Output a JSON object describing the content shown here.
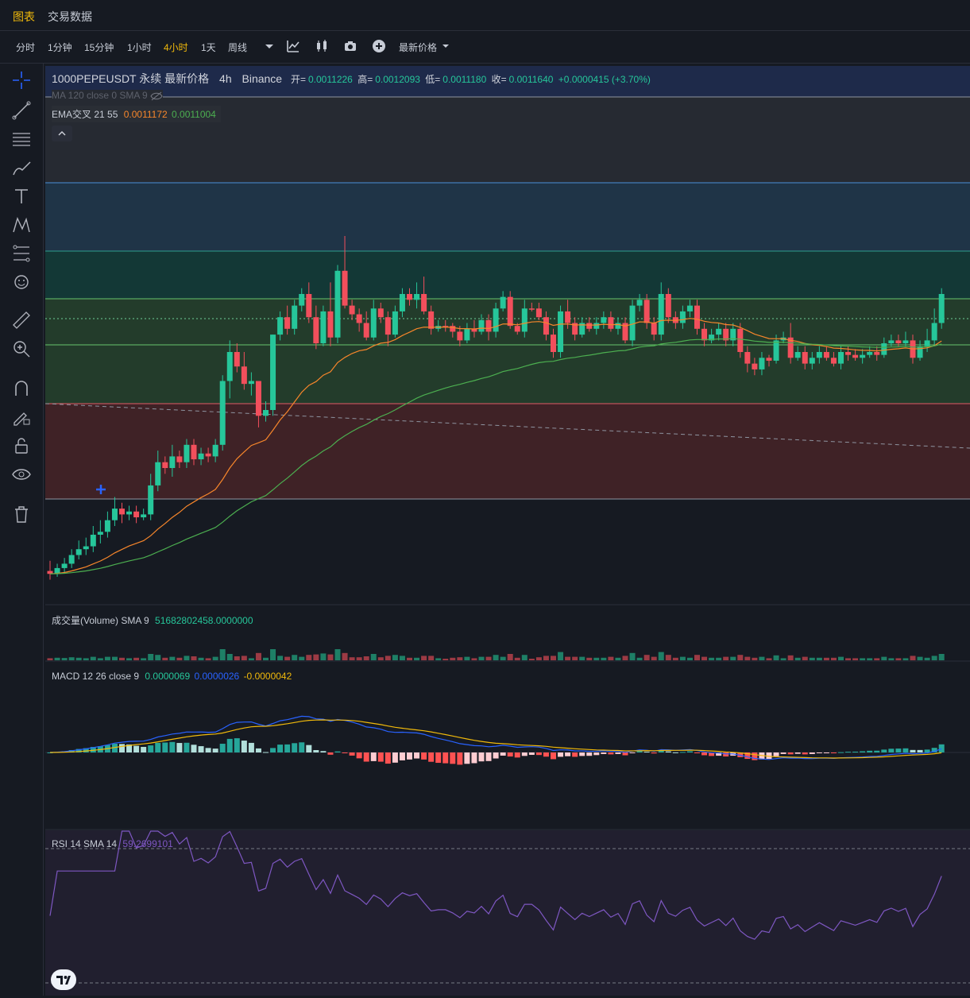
{
  "top_tabs": [
    {
      "label": "图表",
      "active": true
    },
    {
      "label": "交易数据",
      "active": false
    }
  ],
  "timeframes": [
    {
      "label": "分时",
      "active": false
    },
    {
      "label": "1分钟",
      "active": false
    },
    {
      "label": "15分钟",
      "active": false
    },
    {
      "label": "1小时",
      "active": false
    },
    {
      "label": "4小时",
      "active": true
    },
    {
      "label": "1天",
      "active": false
    },
    {
      "label": "周线",
      "active": false
    }
  ],
  "price_type_label": "最新价格",
  "header": {
    "symbol": "1000PEPEUSDT 永续 最新价格",
    "interval": "4h",
    "exchange": "Binance",
    "open_label": "开=",
    "open": "0.0011226",
    "high_label": "高=",
    "high": "0.0012093",
    "low_label": "低=",
    "low": "0.0011180",
    "close_label": "收=",
    "close": "0.0011640",
    "change": "+0.0000415 (+3.70%)"
  },
  "ma_legend": "MA 120 close 0 SMA 9",
  "ema_legend": {
    "label": "EMA交叉 21 55",
    "v1": "0.0011172",
    "v2": "0.0011004"
  },
  "volume_legend": {
    "label": "成交量(Volume) SMA 9",
    "value": "51682802458.0000000"
  },
  "macd_legend": {
    "label": "MACD 12 26 close 9",
    "hist": "0.0000069",
    "macd": "0.0000026",
    "signal": "-0.0000042"
  },
  "rsi_legend": {
    "label": "RSI 14 SMA 14",
    "value": "59.2699101"
  },
  "colors": {
    "up": "#26c69a",
    "down": "#f24f5c",
    "accent": "#f0b90b",
    "ema_fast": "#f7862b",
    "ema_slow": "#4caf50",
    "macd_line": "#2962ff",
    "signal_line": "#f0b90b",
    "rsi": "#7e57c2"
  },
  "chart_data": {
    "type": "candlestick",
    "symbol": "1000PEPEUSDT",
    "interval": "4h",
    "candles_rel": [
      [
        0.955,
        0.965,
        0.92,
        0.985
      ],
      [
        0.965,
        0.945,
        0.93,
        0.975
      ],
      [
        0.945,
        0.93,
        0.91,
        0.96
      ],
      [
        0.93,
        0.9,
        0.88,
        0.945
      ],
      [
        0.9,
        0.88,
        0.85,
        0.915
      ],
      [
        0.88,
        0.87,
        0.84,
        0.9
      ],
      [
        0.87,
        0.83,
        0.8,
        0.89
      ],
      [
        0.83,
        0.82,
        0.78,
        0.86
      ],
      [
        0.82,
        0.78,
        0.75,
        0.84
      ],
      [
        0.78,
        0.74,
        0.7,
        0.8
      ],
      [
        0.74,
        0.76,
        0.72,
        0.79
      ],
      [
        0.76,
        0.75,
        0.73,
        0.78
      ],
      [
        0.75,
        0.77,
        0.73,
        0.79
      ],
      [
        0.77,
        0.76,
        0.74,
        0.78
      ],
      [
        0.76,
        0.66,
        0.62,
        0.78
      ],
      [
        0.66,
        0.58,
        0.54,
        0.68
      ],
      [
        0.58,
        0.6,
        0.56,
        0.62
      ],
      [
        0.6,
        0.56,
        0.52,
        0.63
      ],
      [
        0.56,
        0.58,
        0.54,
        0.6
      ],
      [
        0.58,
        0.52,
        0.5,
        0.6
      ],
      [
        0.52,
        0.57,
        0.5,
        0.59
      ],
      [
        0.57,
        0.55,
        0.53,
        0.59
      ],
      [
        0.55,
        0.56,
        0.53,
        0.58
      ],
      [
        0.56,
        0.52,
        0.5,
        0.58
      ],
      [
        0.52,
        0.3,
        0.28,
        0.54
      ],
      [
        0.3,
        0.2,
        0.16,
        0.36
      ],
      [
        0.2,
        0.25,
        0.17,
        0.27
      ],
      [
        0.25,
        0.31,
        0.2,
        0.33
      ],
      [
        0.31,
        0.3,
        0.27,
        0.35
      ],
      [
        0.3,
        0.42,
        0.3,
        0.46
      ],
      [
        0.42,
        0.4,
        0.37,
        0.44
      ],
      [
        0.4,
        0.14,
        0.14,
        0.42
      ],
      [
        0.14,
        0.08,
        0.06,
        0.16
      ],
      [
        0.08,
        0.12,
        0.04,
        0.14
      ],
      [
        0.12,
        0.04,
        0.02,
        0.14
      ],
      [
        0.04,
        0.0,
        -0.02,
        0.06
      ],
      [
        0.0,
        0.08,
        -0.04,
        0.1
      ],
      [
        0.08,
        0.17,
        0.04,
        0.19
      ],
      [
        0.17,
        0.06,
        0.04,
        0.18
      ],
      [
        0.06,
        0.15,
        -0.04,
        0.18
      ],
      [
        0.15,
        -0.08,
        -0.1,
        0.17
      ],
      [
        -0.08,
        0.04,
        -0.2,
        0.05
      ],
      [
        0.04,
        0.07,
        0.02,
        0.09
      ],
      [
        0.07,
        0.1,
        0.05,
        0.13
      ],
      [
        0.1,
        0.15,
        0.06,
        0.16
      ],
      [
        0.15,
        0.05,
        0.02,
        0.16
      ],
      [
        0.05,
        0.08,
        0.03,
        0.1
      ],
      [
        0.08,
        0.14,
        0.06,
        0.18
      ],
      [
        0.14,
        0.06,
        0.04,
        0.15
      ],
      [
        0.06,
        0.0,
        -0.02,
        0.08
      ],
      [
        0.0,
        0.02,
        -0.02,
        0.04
      ],
      [
        0.02,
        0.0,
        -0.04,
        0.05
      ],
      [
        0.0,
        0.06,
        -0.06,
        0.07
      ],
      [
        0.06,
        0.12,
        0.04,
        0.14
      ],
      [
        0.12,
        0.11,
        0.09,
        0.13
      ],
      [
        0.11,
        0.11,
        0.09,
        0.13
      ],
      [
        0.11,
        0.13,
        0.1,
        0.15
      ],
      [
        0.13,
        0.16,
        0.11,
        0.18
      ],
      [
        0.16,
        0.12,
        0.1,
        0.17
      ],
      [
        0.12,
        0.13,
        0.09,
        0.15
      ],
      [
        0.13,
        0.09,
        0.07,
        0.14
      ],
      [
        0.09,
        0.13,
        0.07,
        0.16
      ],
      [
        0.13,
        0.05,
        0.03,
        0.15
      ],
      [
        0.05,
        0.01,
        -0.01,
        0.06
      ],
      [
        0.01,
        0.11,
        -0.01,
        0.12
      ],
      [
        0.11,
        0.13,
        0.1,
        0.14
      ],
      [
        0.13,
        0.05,
        0.02,
        0.15
      ],
      [
        0.05,
        0.05,
        0.03,
        0.06
      ],
      [
        0.05,
        0.08,
        0.03,
        0.09
      ],
      [
        0.08,
        0.14,
        0.06,
        0.16
      ],
      [
        0.14,
        0.2,
        0.12,
        0.22
      ],
      [
        0.2,
        0.06,
        0.04,
        0.22
      ],
      [
        0.06,
        0.1,
        0.02,
        0.12
      ],
      [
        0.1,
        0.14,
        0.08,
        0.16
      ],
      [
        0.14,
        0.1,
        0.08,
        0.15
      ],
      [
        0.1,
        0.12,
        0.08,
        0.13
      ],
      [
        0.12,
        0.1,
        0.08,
        0.14
      ],
      [
        0.1,
        0.08,
        0.06,
        0.12
      ],
      [
        0.08,
        0.12,
        0.06,
        0.13
      ],
      [
        0.12,
        0.1,
        0.08,
        0.14
      ],
      [
        0.1,
        0.16,
        0.08,
        0.17
      ],
      [
        0.16,
        0.04,
        0.02,
        0.18
      ],
      [
        0.04,
        0.02,
        0.0,
        0.06
      ],
      [
        0.02,
        0.1,
        0.0,
        0.12
      ],
      [
        0.1,
        0.14,
        0.08,
        0.16
      ],
      [
        0.14,
        0.0,
        -0.04,
        0.16
      ],
      [
        0.0,
        0.08,
        -0.02,
        0.1
      ],
      [
        0.08,
        0.1,
        0.06,
        0.12
      ],
      [
        0.1,
        0.06,
        0.04,
        0.12
      ],
      [
        0.06,
        0.04,
        0.02,
        0.08
      ],
      [
        0.04,
        0.12,
        0.02,
        0.14
      ],
      [
        0.12,
        0.16,
        0.1,
        0.18
      ],
      [
        0.16,
        0.14,
        0.12,
        0.17
      ],
      [
        0.14,
        0.12,
        0.1,
        0.16
      ],
      [
        0.12,
        0.16,
        0.1,
        0.18
      ],
      [
        0.16,
        0.12,
        0.1,
        0.18
      ],
      [
        0.12,
        0.2,
        0.1,
        0.22
      ],
      [
        0.2,
        0.24,
        0.18,
        0.27
      ],
      [
        0.24,
        0.26,
        0.22,
        0.28
      ],
      [
        0.26,
        0.22,
        0.2,
        0.28
      ],
      [
        0.22,
        0.23,
        0.21,
        0.25
      ],
      [
        0.23,
        0.16,
        0.14,
        0.24
      ],
      [
        0.16,
        0.15,
        0.13,
        0.17
      ],
      [
        0.15,
        0.22,
        0.1,
        0.24
      ],
      [
        0.22,
        0.2,
        0.18,
        0.23
      ],
      [
        0.2,
        0.24,
        0.18,
        0.26
      ],
      [
        0.24,
        0.22,
        0.2,
        0.26
      ],
      [
        0.22,
        0.2,
        0.18,
        0.24
      ],
      [
        0.2,
        0.22,
        0.18,
        0.23
      ],
      [
        0.22,
        0.24,
        0.2,
        0.25
      ],
      [
        0.24,
        0.2,
        0.18,
        0.26
      ],
      [
        0.2,
        0.21,
        0.18,
        0.23
      ],
      [
        0.21,
        0.22,
        0.19,
        0.23
      ],
      [
        0.22,
        0.21,
        0.19,
        0.24
      ],
      [
        0.21,
        0.2,
        0.18,
        0.22
      ],
      [
        0.2,
        0.21,
        0.18,
        0.23
      ],
      [
        0.21,
        0.17,
        0.15,
        0.22
      ],
      [
        0.17,
        0.16,
        0.14,
        0.18
      ],
      [
        0.16,
        0.17,
        0.14,
        0.18
      ],
      [
        0.17,
        0.16,
        0.13,
        0.18
      ],
      [
        0.16,
        0.22,
        0.14,
        0.24
      ],
      [
        0.22,
        0.18,
        0.16,
        0.23
      ],
      [
        0.18,
        0.16,
        0.12,
        0.2
      ],
      [
        0.16,
        0.1,
        0.05,
        0.18
      ],
      [
        0.1,
        0.0,
        -0.02,
        0.12
      ]
    ]
  }
}
